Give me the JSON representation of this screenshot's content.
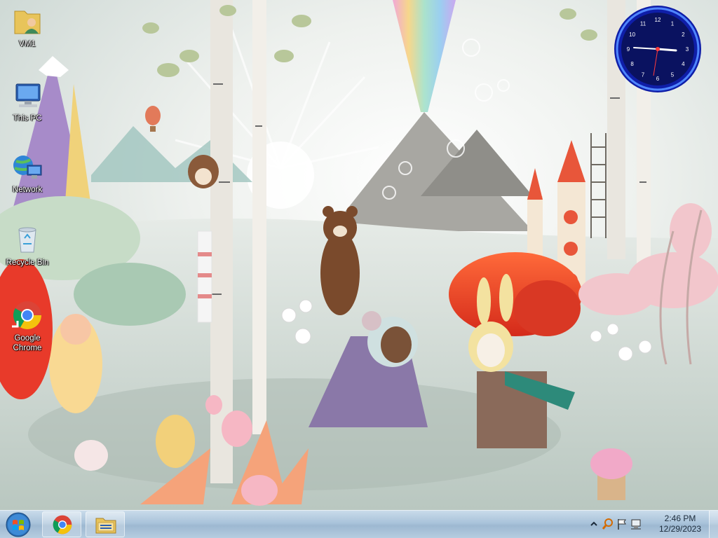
{
  "desktop": {
    "icons": [
      {
        "label": "VM1",
        "icon": "user-folder-icon"
      },
      {
        "label": "This PC",
        "icon": "computer-icon"
      },
      {
        "label": "Network",
        "icon": "network-icon"
      },
      {
        "label": "Recycle Bin",
        "icon": "recycle-bin-icon"
      },
      {
        "label": "Google Chrome",
        "icon": "chrome-icon"
      }
    ]
  },
  "clock_gadget": {
    "numerals": [
      "12",
      "1",
      "2",
      "3",
      "4",
      "5",
      "6",
      "7",
      "8",
      "9",
      "10",
      "11"
    ],
    "accent": "#1a3fd8"
  },
  "taskbar": {
    "pinned": [
      {
        "name": "start-button",
        "icon": "windows-logo-icon"
      },
      {
        "name": "chrome-taskbar-button",
        "icon": "chrome-icon"
      },
      {
        "name": "file-explorer-taskbar-button",
        "icon": "folder-icon"
      }
    ],
    "tray": {
      "icons": [
        "show-hidden-icons-chevron",
        "search-icon",
        "flag-icon",
        "network-icon"
      ],
      "time": "2:46 PM",
      "date": "12/29/2023"
    }
  },
  "colors": {
    "taskbar": "#a9c3da",
    "icon_text": "#ffffff",
    "wallpaper_sky": "#e8ecea"
  }
}
